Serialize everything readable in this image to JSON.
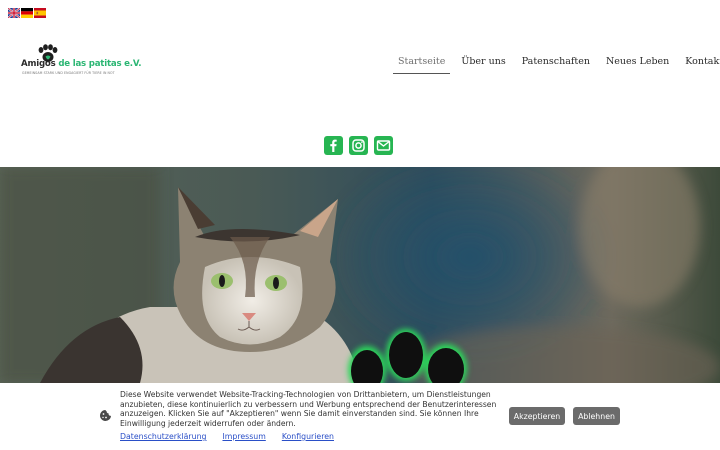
{
  "languages": [
    {
      "code": "en",
      "name": "English"
    },
    {
      "code": "de",
      "name": "Deutsch"
    },
    {
      "code": "es",
      "name": "Español"
    }
  ],
  "logo": {
    "name_part1": "Amigos ",
    "name_part2": "de las patitas e.V.",
    "tagline": "GEMEINSAM STARK UND ENGAGIERT FÜR TIERE IN NOT",
    "brand_color": "#2bb673"
  },
  "nav": {
    "items": [
      "Startseite",
      "Über uns",
      "Patenschaften",
      "Neues Leben",
      "Kontakt"
    ],
    "more_label": "···",
    "active_index": 0
  },
  "social": {
    "accent_color": "#27b552",
    "icons": [
      "facebook-icon",
      "instagram-icon",
      "mail-icon"
    ]
  },
  "hero": {
    "subject": "cat-photo",
    "overlay_icon": "paw-icon"
  },
  "cookie_banner": {
    "text": "Diese Website verwendet Website-Tracking-Technologien von Drittanbietern, um Dienstleistungen anzubieten, diese kontinuierlich zu verbessern und Werbung entsprechend der Benutzerinteressen anzuzeigen. Klicken Sie auf \"Akzeptieren\" wenn Sie damit einverstanden sind. Sie können Ihre Einwilligung jederzeit widerrufen oder ändern.",
    "links": [
      "Datenschutzerklärung",
      "Impressum",
      "Konfigurieren"
    ],
    "accept_label": "Akzeptieren",
    "decline_label": "Ablehnen",
    "icon": "cookie-icon"
  }
}
